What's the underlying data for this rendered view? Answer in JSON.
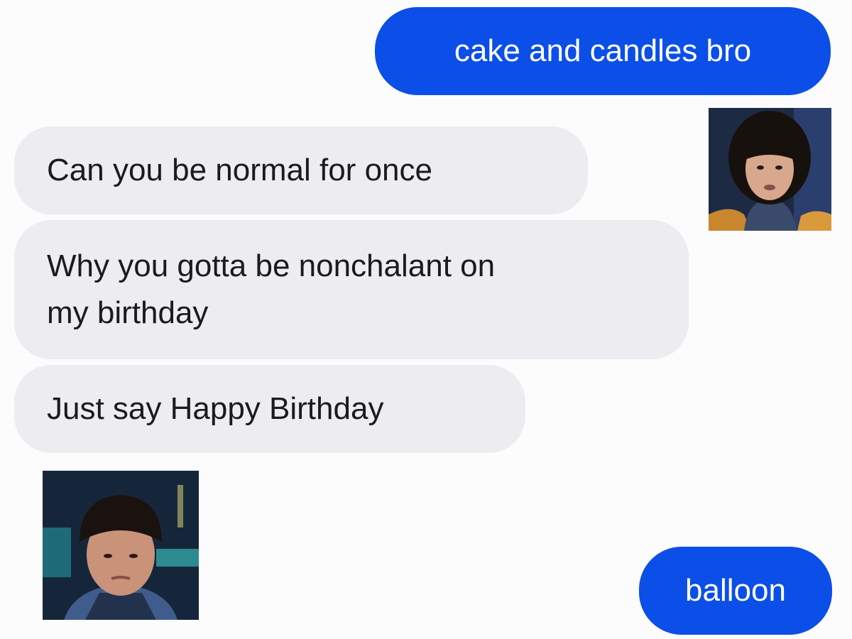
{
  "messages": [
    {
      "side": "sent",
      "text": "cake and candles bro"
    },
    {
      "side": "received",
      "text": "Can you be normal for once"
    },
    {
      "side": "received",
      "lines": [
        "Why you gotta be nonchalant on",
        "my birthday"
      ]
    },
    {
      "side": "received",
      "text": "Just say Happy Birthday"
    },
    {
      "side": "sent",
      "text": "balloon"
    }
  ],
  "images": [
    {
      "icon": "person-reaction-photo-shocked"
    },
    {
      "icon": "person-reaction-photo-sad"
    }
  ],
  "colors": {
    "background": "#fcfcfd",
    "sent_bubble": "#0b4fe8",
    "received_bubble": "#ececf1",
    "received_text": "#1b1b1e"
  }
}
